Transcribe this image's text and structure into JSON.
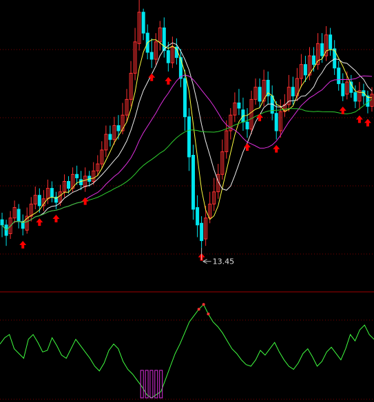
{
  "chart_data": {
    "type": "candlestick",
    "low_price_label": "13.45",
    "colors": {
      "up": "#ff3030",
      "down": "#00e5ee",
      "ma_white": "#f0f0f0",
      "ma_yellow": "#ffff40",
      "ma_magenta": "#e030e0",
      "ma_green": "#30d030",
      "osc": "#40ff40",
      "arrow_up": "#ff0000",
      "arrow_down": "#30ff30",
      "grid": "#800000"
    },
    "candles": [
      [
        48,
        42,
        56,
        28
      ],
      [
        42,
        30,
        48,
        18
      ],
      [
        32,
        50,
        58,
        26
      ],
      [
        50,
        62,
        70,
        44
      ],
      [
        60,
        46,
        66,
        38
      ],
      [
        46,
        38,
        54,
        30
      ],
      [
        36,
        52,
        62,
        32
      ],
      [
        52,
        66,
        74,
        46
      ],
      [
        66,
        76,
        86,
        60
      ],
      [
        76,
        64,
        84,
        56
      ],
      [
        64,
        72,
        82,
        58
      ],
      [
        72,
        84,
        94,
        66
      ],
      [
        84,
        74,
        92,
        68
      ],
      [
        74,
        68,
        80,
        60
      ],
      [
        68,
        80,
        88,
        64
      ],
      [
        80,
        92,
        100,
        74
      ],
      [
        92,
        84,
        98,
        78
      ],
      [
        84,
        100,
        108,
        80
      ],
      [
        100,
        96,
        110,
        88
      ],
      [
        94,
        88,
        104,
        82
      ],
      [
        86,
        98,
        108,
        80
      ],
      [
        98,
        92,
        104,
        86
      ],
      [
        92,
        104,
        114,
        88
      ],
      [
        104,
        112,
        122,
        98
      ],
      [
        112,
        128,
        138,
        106
      ],
      [
        128,
        146,
        156,
        120
      ],
      [
        146,
        140,
        156,
        132
      ],
      [
        140,
        156,
        166,
        134
      ],
      [
        156,
        150,
        168,
        140
      ],
      [
        150,
        168,
        182,
        146
      ],
      [
        168,
        186,
        198,
        160
      ],
      [
        186,
        216,
        230,
        178
      ],
      [
        216,
        252,
        268,
        208
      ],
      [
        250,
        286,
        300,
        242
      ],
      [
        286,
        262,
        290,
        254
      ],
      [
        262,
        240,
        272,
        232
      ],
      [
        240,
        232,
        256,
        222
      ],
      [
        232,
        252,
        262,
        226
      ],
      [
        252,
        268,
        276,
        242
      ],
      [
        268,
        242,
        280,
        234
      ],
      [
        242,
        228,
        252,
        218
      ],
      [
        228,
        246,
        258,
        222
      ],
      [
        246,
        234,
        256,
        226
      ],
      [
        234,
        210,
        244,
        200
      ],
      [
        210,
        166,
        220,
        150
      ],
      [
        166,
        120,
        176,
        104
      ],
      [
        122,
        60,
        134,
        48
      ],
      [
        62,
        42,
        76,
        28
      ],
      [
        44,
        24,
        52,
        16
      ],
      [
        26,
        50,
        64,
        18
      ],
      [
        50,
        66,
        80,
        44
      ],
      [
        66,
        80,
        96,
        58
      ],
      [
        80,
        100,
        112,
        72
      ],
      [
        100,
        126,
        140,
        94
      ],
      [
        126,
        150,
        162,
        118
      ],
      [
        150,
        168,
        176,
        140
      ],
      [
        168,
        182,
        194,
        160
      ],
      [
        182,
        176,
        198,
        168
      ],
      [
        174,
        160,
        188,
        150
      ],
      [
        160,
        152,
        176,
        142
      ],
      [
        152,
        186,
        196,
        146
      ],
      [
        186,
        200,
        210,
        180
      ],
      [
        200,
        184,
        210,
        176
      ],
      [
        184,
        208,
        220,
        178
      ],
      [
        208,
        190,
        218,
        180
      ],
      [
        190,
        170,
        202,
        162
      ],
      [
        170,
        150,
        184,
        140
      ],
      [
        150,
        172,
        186,
        142
      ],
      [
        172,
        180,
        192,
        166
      ],
      [
        180,
        200,
        214,
        172
      ],
      [
        200,
        190,
        212,
        180
      ],
      [
        190,
        210,
        222,
        184
      ],
      [
        210,
        226,
        238,
        200
      ],
      [
        226,
        214,
        236,
        206
      ],
      [
        214,
        236,
        246,
        208
      ],
      [
        236,
        226,
        246,
        218
      ],
      [
        226,
        250,
        262,
        220
      ],
      [
        250,
        236,
        262,
        228
      ],
      [
        236,
        260,
        270,
        230
      ],
      [
        260,
        244,
        268,
        236
      ],
      [
        244,
        222,
        254,
        214
      ],
      [
        222,
        204,
        230,
        196
      ],
      [
        204,
        190,
        216,
        184
      ],
      [
        192,
        206,
        218,
        186
      ],
      [
        206,
        194,
        214,
        188
      ],
      [
        194,
        184,
        202,
        176
      ],
      [
        184,
        196,
        206,
        174
      ],
      [
        196,
        190,
        204,
        180
      ],
      [
        190,
        178,
        196,
        170
      ],
      [
        178,
        192,
        200,
        172
      ]
    ],
    "osc_values": [
      68,
      76,
      80,
      62,
      56,
      50,
      74,
      80,
      70,
      58,
      60,
      76,
      66,
      54,
      50,
      62,
      74,
      66,
      58,
      50,
      40,
      34,
      44,
      60,
      68,
      62,
      46,
      36,
      30,
      22,
      14,
      4,
      0,
      4,
      8,
      24,
      40,
      56,
      68,
      82,
      96,
      104,
      112,
      118,
      106,
      96,
      90,
      82,
      72,
      62,
      56,
      48,
      42,
      40,
      48,
      60,
      54,
      62,
      70,
      58,
      48,
      40,
      36,
      44,
      56,
      62,
      52,
      40,
      46,
      58,
      64,
      56,
      48,
      62,
      80,
      72,
      86,
      92,
      80,
      74
    ],
    "osc_range": [
      0,
      120
    ]
  }
}
